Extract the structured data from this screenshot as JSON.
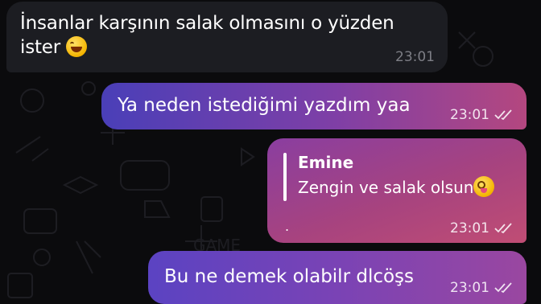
{
  "messages": [
    {
      "id": "incoming-1",
      "direction": "incoming",
      "text": "İnsanlar karşının salak olmasını o yüzden ister",
      "emoji": "rofl-emoji",
      "time": "23:01"
    },
    {
      "id": "outgoing-1",
      "direction": "outgoing",
      "text": "Ya neden istediğimi yazdım yaa",
      "time": "23:01",
      "status": "read"
    },
    {
      "id": "outgoing-2",
      "direction": "outgoing",
      "reply": {
        "author": "Emine",
        "text": "Zengin ve salak olsun",
        "emoji": "zany-face-emoji"
      },
      "text": ".",
      "time": "23:01",
      "status": "read"
    },
    {
      "id": "outgoing-3",
      "direction": "outgoing",
      "text": "Bu ne demek olabilr dlcöşs",
      "time": "23:01",
      "status": "read"
    }
  ],
  "colors": {
    "background": "#0b0b0d",
    "incoming_bubble": "#1c1d22",
    "outgoing_gradient_start": "#4a3fb8",
    "outgoing_gradient_end": "#c04d74"
  },
  "icons": {
    "read_receipt": "double-check-icon"
  }
}
